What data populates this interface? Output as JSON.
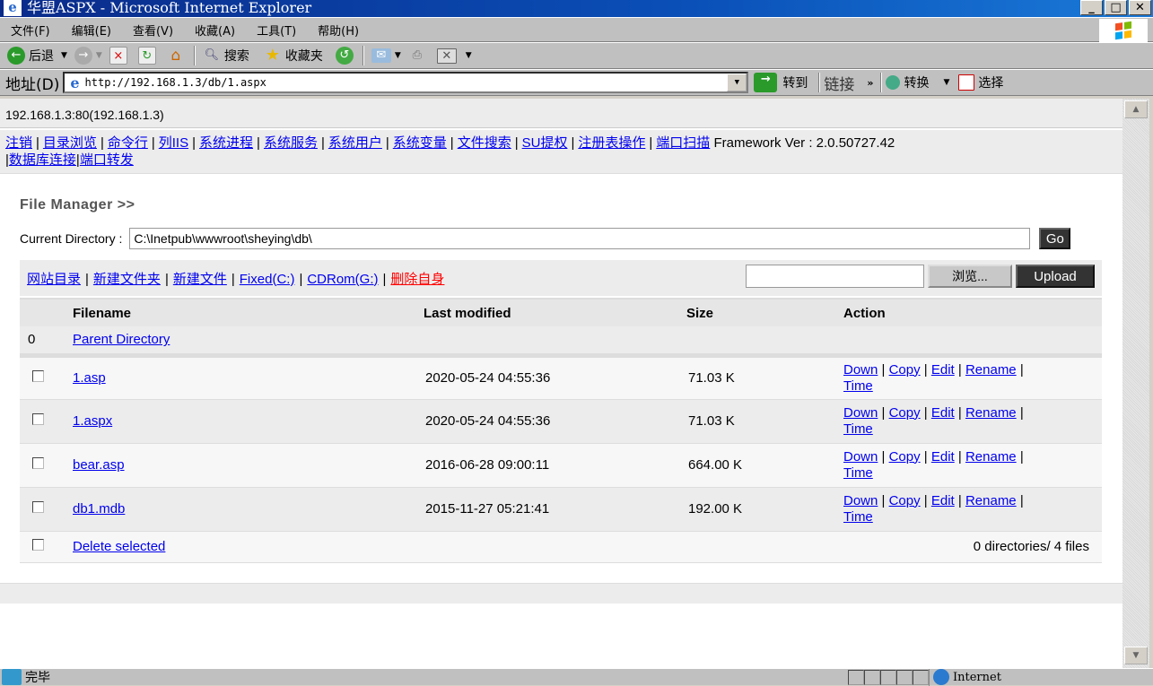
{
  "window": {
    "title": "华盟ASPX - Microsoft Internet Explorer"
  },
  "menu": [
    "文件(F)",
    "编辑(E)",
    "查看(V)",
    "收藏(A)",
    "工具(T)",
    "帮助(H)"
  ],
  "toolbar": {
    "back": "后退",
    "search": "搜索",
    "favorites": "收藏夹"
  },
  "address": {
    "label": "地址(D)",
    "url": "http://192.168.1.3/db/1.aspx",
    "go": "转到",
    "links": "链接",
    "convert": "转换",
    "select": "选择"
  },
  "page": {
    "host": "192.168.1.3:80(192.168.1.3)",
    "nav": [
      "注销",
      "目录浏览",
      "命令行",
      "列IIS",
      "系统进程",
      "系统服务",
      "系统用户",
      "系统变量",
      "文件搜索",
      "SU提权",
      "注册表操作",
      "端口扫描"
    ],
    "framework": "Framework Ver : 2.0.50727.42",
    "nav2": [
      "数据库连接",
      "端口转发"
    ],
    "title": "File Manager >>",
    "cd_label": "Current Directory :",
    "cd_value": "C:\\Inetpub\\wwwroot\\sheying\\db\\",
    "go": "Go",
    "tools": [
      "网站目录",
      "新建文件夹",
      "新建文件",
      "Fixed(C:)",
      "CDRom(G:)"
    ],
    "delete_self": "删除自身",
    "browse": "浏览...",
    "upload": "Upload",
    "headers": [
      "Filename",
      "Last modified",
      "Size",
      "Action"
    ],
    "parent_num": "0",
    "parent": "Parent Directory",
    "files": [
      {
        "name": "1.asp",
        "modified": "2020-05-24 04:55:36",
        "size": "71.03 K"
      },
      {
        "name": "1.aspx",
        "modified": "2020-05-24 04:55:36",
        "size": "71.03 K"
      },
      {
        "name": "bear.asp",
        "modified": "2016-06-28 09:00:11",
        "size": "664.00 K"
      },
      {
        "name": "db1.mdb",
        "modified": "2015-11-27 05:21:41",
        "size": "192.00 K"
      }
    ],
    "actions": [
      "Down",
      "Copy",
      "Edit",
      "Rename",
      "Time"
    ],
    "delete_selected": "Delete selected",
    "summary": "0 directories/ 4 files"
  },
  "status": {
    "text": "完毕",
    "zone": "Internet"
  }
}
